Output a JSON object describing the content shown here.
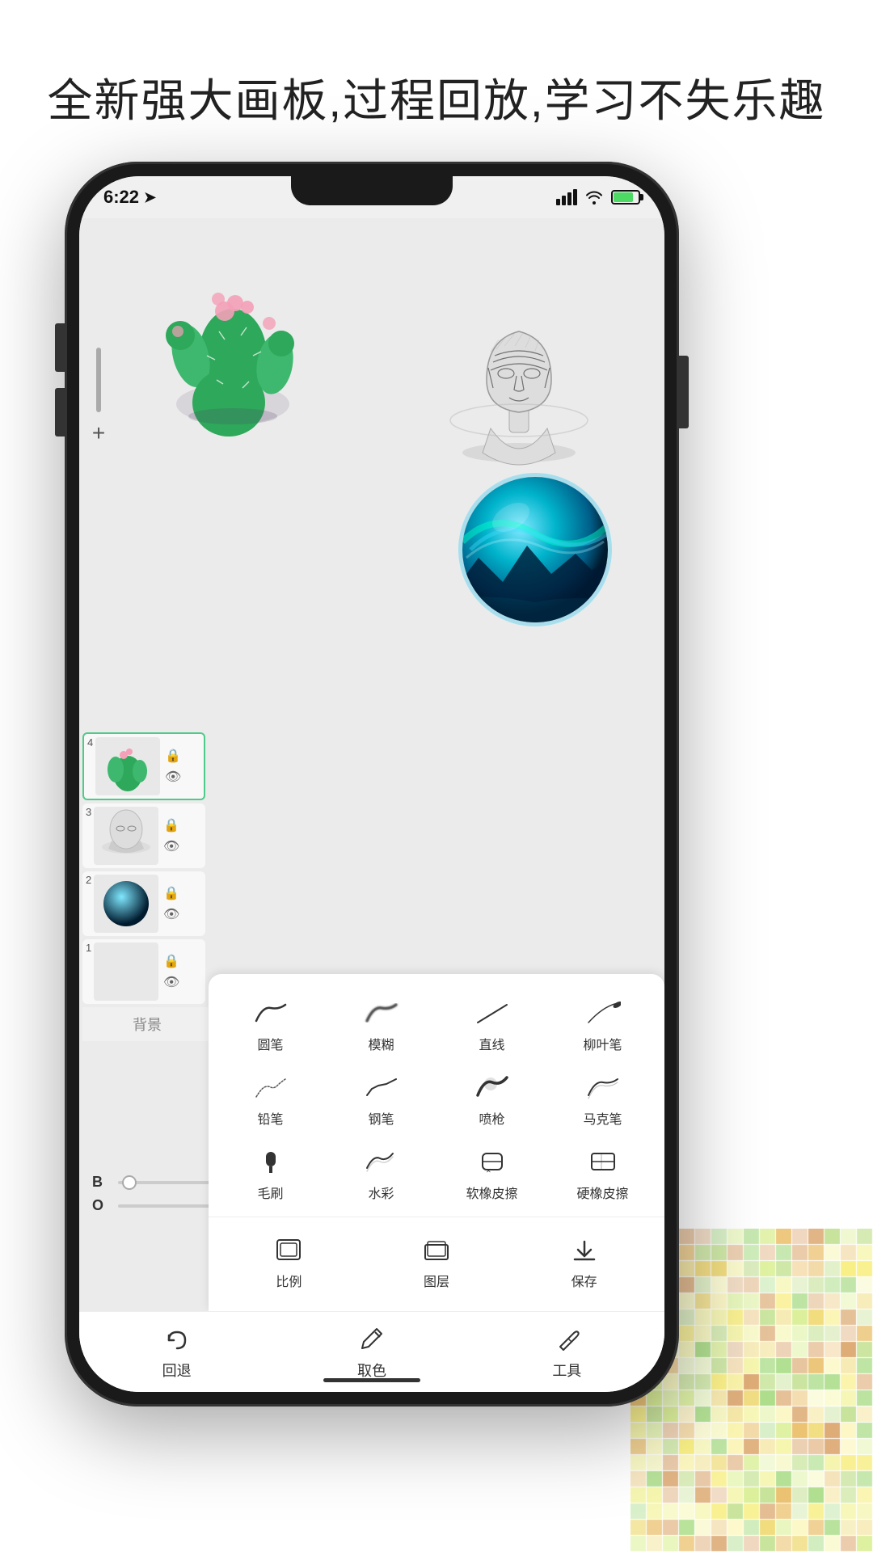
{
  "page": {
    "title": "全新强大画板,过程回放,学习不失乐趣",
    "status_bar": {
      "time": "6:22",
      "location_arrow": "➤"
    }
  },
  "layers": [
    {
      "num": "4",
      "active": true,
      "label": "cactus"
    },
    {
      "num": "3",
      "active": false,
      "label": "bust"
    },
    {
      "num": "2",
      "active": false,
      "label": "planet"
    },
    {
      "num": "1",
      "active": false,
      "label": "empty"
    }
  ],
  "bg_label": "背景",
  "tools": {
    "brushes": [
      {
        "id": "round-pen",
        "label": "圆笔"
      },
      {
        "id": "blur-pen",
        "label": "模糊"
      },
      {
        "id": "line-pen",
        "label": "直线"
      },
      {
        "id": "willow-pen",
        "label": "柳叶笔"
      },
      {
        "id": "pencil",
        "label": "铅笔"
      },
      {
        "id": "steel-pen",
        "label": "钢笔"
      },
      {
        "id": "spray",
        "label": "喷枪"
      },
      {
        "id": "marker",
        "label": "马克笔"
      },
      {
        "id": "brush",
        "label": "毛刷"
      },
      {
        "id": "watercolor",
        "label": "水彩"
      },
      {
        "id": "soft-eraser",
        "label": "软橡皮擦"
      },
      {
        "id": "hard-eraser",
        "label": "硬橡皮擦"
      }
    ],
    "actions": [
      {
        "id": "ratio",
        "label": "比例"
      },
      {
        "id": "layers",
        "label": "图层"
      },
      {
        "id": "save",
        "label": "保存"
      }
    ]
  },
  "bottom_bar": {
    "undo": {
      "label": "回退"
    },
    "color_pick": {
      "label": "取色"
    },
    "tools": {
      "label": "工具"
    }
  },
  "slider": {
    "b_label": "B",
    "o_label": "O"
  }
}
